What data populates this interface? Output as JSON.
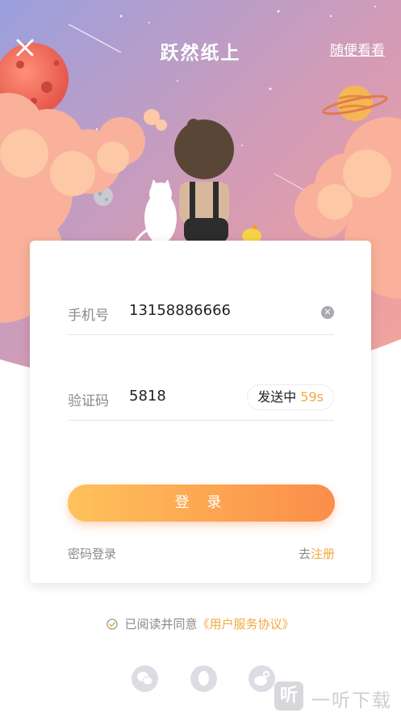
{
  "header": {
    "title": "跃然纸上",
    "browse_label": "随便看看"
  },
  "form": {
    "phone_label": "手机号",
    "phone_value": "13158886666",
    "code_label": "验证码",
    "code_value": "5818",
    "sms_status": "发送中",
    "sms_countdown": "59s",
    "login_label": "登 录",
    "password_login_label": "密码登录",
    "register_prefix": "去",
    "register_label": "注册"
  },
  "agreement": {
    "prefix": "已阅读并同意",
    "link": "《用户服务协议》"
  },
  "social": [
    "wechat-icon",
    "qq-icon",
    "weibo-icon"
  ],
  "watermark": {
    "icon_text": "听",
    "text": "一听下载"
  },
  "colors": {
    "accent": "#f1a940",
    "button_start": "#fec25b",
    "button_end": "#fb8d4a"
  }
}
